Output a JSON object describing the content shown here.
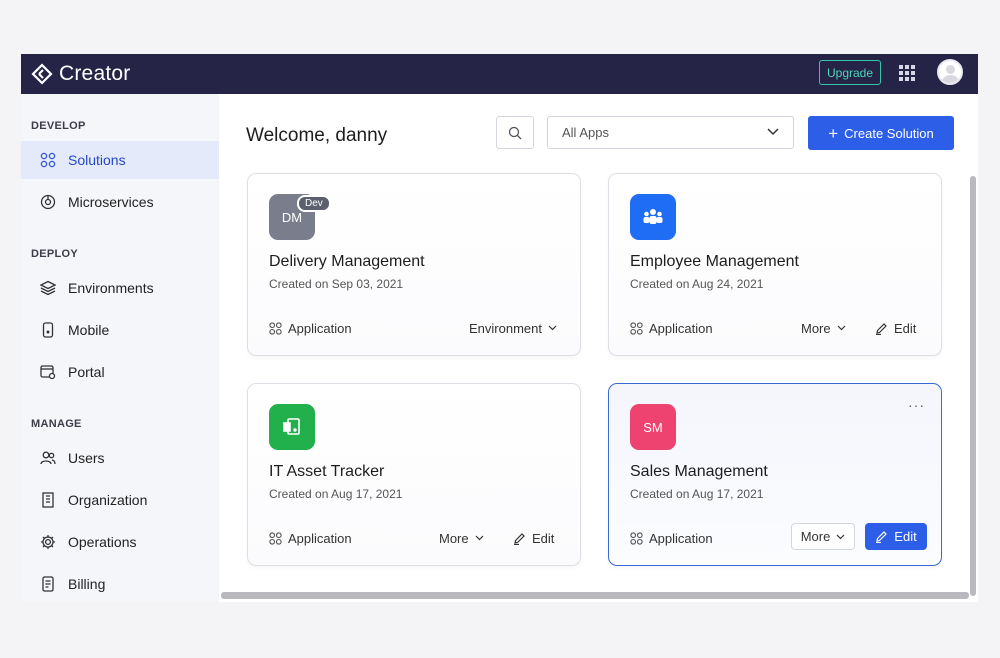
{
  "header": {
    "brand": "Creator",
    "upgrade_label": "Upgrade"
  },
  "sidebar": {
    "sections": [
      {
        "label": "DEVELOP"
      },
      {
        "label": "DEPLOY"
      },
      {
        "label": "MANAGE"
      }
    ],
    "items": [
      {
        "label": "Solutions",
        "icon": "solutions-icon"
      },
      {
        "label": "Microservices",
        "icon": "microservices-icon"
      },
      {
        "label": "Environments",
        "icon": "layers-icon"
      },
      {
        "label": "Mobile",
        "icon": "mobile-icon"
      },
      {
        "label": "Portal",
        "icon": "portal-icon"
      },
      {
        "label": "Users",
        "icon": "users-icon"
      },
      {
        "label": "Organization",
        "icon": "building-icon"
      },
      {
        "label": "Operations",
        "icon": "gear-icon"
      },
      {
        "label": "Billing",
        "icon": "receipt-icon"
      }
    ]
  },
  "main": {
    "welcome": "Welcome, danny",
    "filter_value": "All Apps",
    "create_label": "Create Solution"
  },
  "cards": [
    {
      "initials": "DM",
      "badge": "Dev",
      "title": "Delivery Management",
      "date": "Created on Sep 03, 2021",
      "type": "Application",
      "action1": "Environment",
      "color": "#7a7d8c"
    },
    {
      "initials": "",
      "title": "Employee Management",
      "date": "Created on Aug 24, 2021",
      "type": "Application",
      "action1": "More",
      "action2": "Edit",
      "color": "#1f6df5"
    },
    {
      "initials": "",
      "title": "IT Asset Tracker",
      "date": "Created on Aug 17, 2021",
      "type": "Application",
      "action1": "More",
      "action2": "Edit",
      "color": "#21b04c"
    },
    {
      "initials": "SM",
      "title": "Sales Management",
      "date": "Created on Aug 17, 2021",
      "type": "Application",
      "action1": "More",
      "action2": "Edit",
      "color": "#ee4270",
      "menu": "···"
    }
  ]
}
